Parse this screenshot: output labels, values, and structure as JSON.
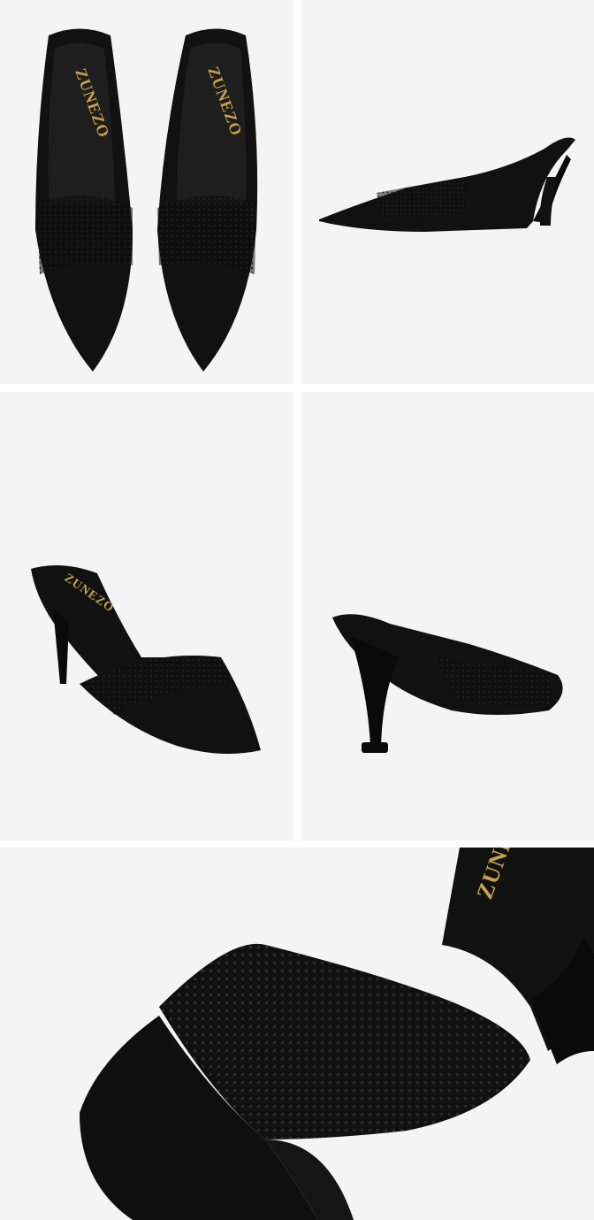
{
  "brand": {
    "logo_text": "ZUNEZO"
  },
  "product": {
    "color": "#0d0d0d",
    "logo_color": "#c8a24a",
    "background": "#f4f4f4"
  },
  "panels": [
    {
      "view": "top-view-pair"
    },
    {
      "view": "side-profile"
    },
    {
      "view": "three-quarter-front"
    },
    {
      "view": "rear-heel-view"
    },
    {
      "view": "close-up-toe"
    }
  ]
}
